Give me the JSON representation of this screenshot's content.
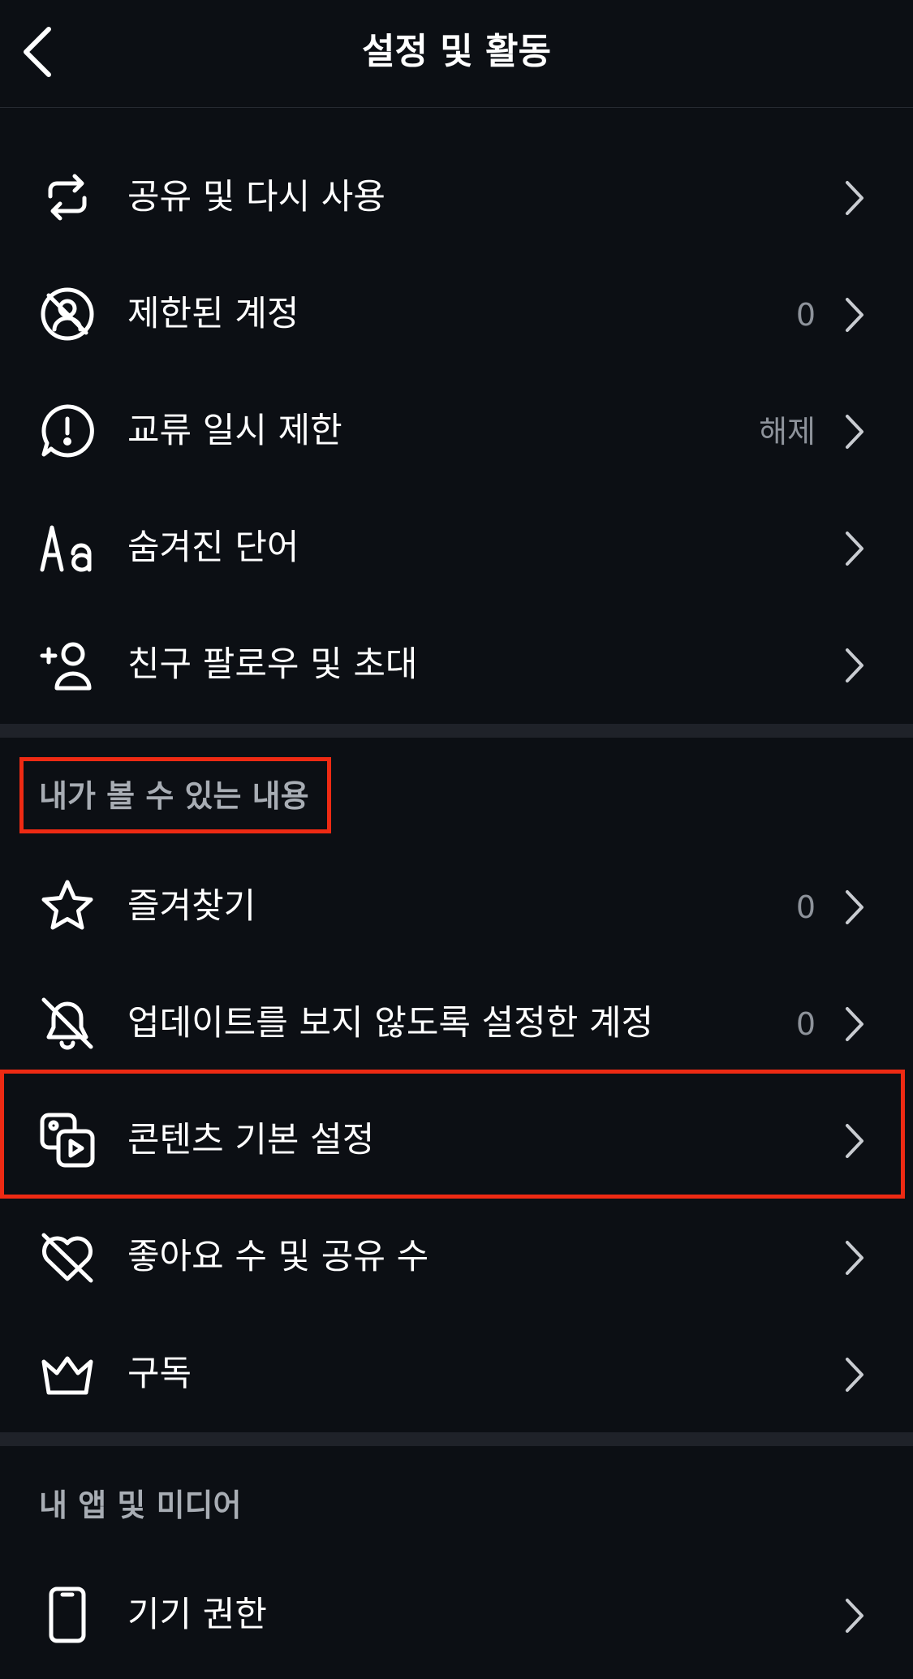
{
  "header": {
    "title": "설정 및 활동"
  },
  "group1": [
    {
      "label": "공유 및 다시 사용",
      "value": "",
      "icon": "repost-icon"
    },
    {
      "label": "제한된 계정",
      "value": "0",
      "icon": "restricted-account-icon"
    },
    {
      "label": "교류 일시 제한",
      "value": "해제",
      "icon": "limit-interactions-icon"
    },
    {
      "label": "숨겨진 단어",
      "value": "",
      "icon": "hidden-words-icon"
    },
    {
      "label": "친구 팔로우 및 초대",
      "value": "",
      "icon": "add-person-icon"
    }
  ],
  "section_what_you_see": {
    "title": "내가 볼 수 있는 내용",
    "items": [
      {
        "label": "즐겨찾기",
        "value": "0",
        "icon": "star-icon"
      },
      {
        "label": "업데이트를 보지 않도록 설정한 계정",
        "value": "0",
        "icon": "muted-bell-icon"
      },
      {
        "label": "콘텐츠 기본 설정",
        "value": "",
        "icon": "content-media-icon"
      },
      {
        "label": "좋아요 수 및 공유 수",
        "value": "",
        "icon": "hidden-likes-icon"
      },
      {
        "label": "구독",
        "value": "",
        "icon": "crown-icon"
      }
    ]
  },
  "section_apps_media": {
    "title": "내 앱 및 미디어",
    "items": [
      {
        "label": "기기 권한",
        "value": "",
        "icon": "phone-icon"
      }
    ]
  },
  "colors": {
    "background": "#0c0f14",
    "highlight": "#ee2a13",
    "secondary_text": "#8e939b"
  }
}
